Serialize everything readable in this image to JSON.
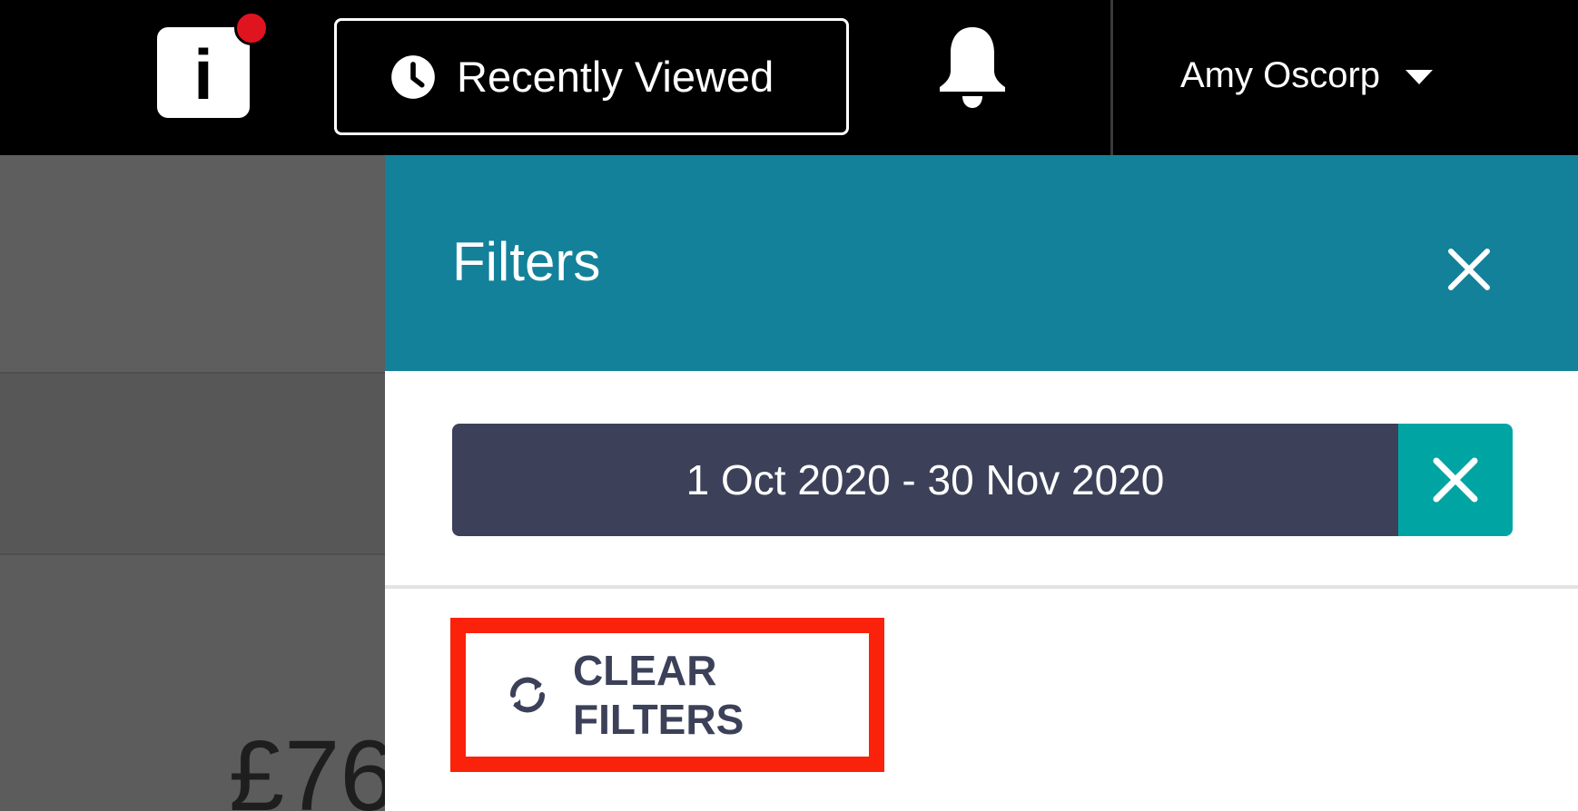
{
  "topbar": {
    "info_label": "i",
    "recently_viewed_label": "Recently Viewed",
    "user_name": "Amy Oscorp"
  },
  "background": {
    "amount_partial": "£76"
  },
  "filters_panel": {
    "title": "Filters",
    "active_filter": "1 Oct 2020 - 30 Nov 2020",
    "clear_label": "CLEAR FILTERS"
  },
  "icons": {
    "info": "info-icon",
    "notification_dot": "notification-dot",
    "clock": "clock-icon",
    "bell": "bell-icon",
    "caret": "chevron-down-icon",
    "close": "close-icon",
    "remove_filter": "close-icon",
    "refresh": "refresh-icon"
  },
  "colors": {
    "topbar": "#000000",
    "panel_header": "#14819b",
    "chip": "#3c4159",
    "chip_remove": "#00a5a3",
    "highlight": "#fa220a",
    "notification": "#e0141e"
  }
}
